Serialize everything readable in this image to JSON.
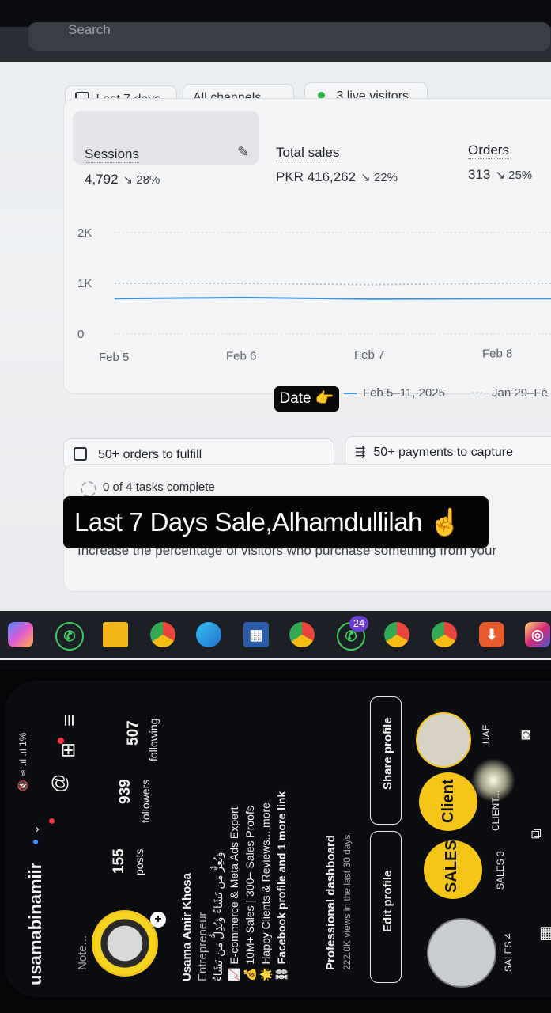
{
  "laptop": {
    "search_placeholder": "Search",
    "filters": {
      "date_range": "Last 7 days",
      "channels": "All channels",
      "live_visitors": "3 live visitors"
    },
    "metrics": [
      {
        "label": "Sessions",
        "value": "4,792",
        "change": "28%"
      },
      {
        "label": "Total sales",
        "value": "PKR 416,262",
        "change": "22%"
      },
      {
        "label": "Orders",
        "value": "313",
        "change": "25%"
      }
    ],
    "chart_data": {
      "type": "line",
      "title": "",
      "xlabel": "",
      "ylabel": "",
      "y_ticks": [
        "2K",
        "1K",
        "0"
      ],
      "ylim": [
        0,
        2000
      ],
      "categories": [
        "Feb 5",
        "Feb 6",
        "Feb 7",
        "Feb 8"
      ],
      "series": [
        {
          "name": "Feb 5–11, 2025",
          "values": [
            700,
            720,
            690,
            700
          ],
          "style": "solid",
          "color": "#3d8fd6"
        },
        {
          "name": "Jan 29–Fe",
          "values": [
            1000,
            1000,
            970,
            1000
          ],
          "style": "dotted",
          "color": "#a9b8c9"
        }
      ],
      "grid": true
    },
    "date_sticker": "Date 👉",
    "actions": {
      "orders": "50+ orders to fulfill",
      "payments": "50+ payments to capture"
    },
    "tasks": {
      "status": "0 of 4 tasks complete",
      "description": "Increase the percentage of visitors who purchase something from your"
    },
    "headline": "Last 7 Days Sale,Alhamdullilah ☝️",
    "taskbar_badge": "24"
  },
  "phone": {
    "status": "🔇 ≋ .ıl .ıl 1%",
    "username": "usamabinamiir",
    "note": "Note...",
    "stats": [
      {
        "value": "155",
        "label": "posts"
      },
      {
        "value": "939",
        "label": "followers"
      },
      {
        "value": "507",
        "label": "following"
      }
    ],
    "bio": {
      "name": "Usama Amir Khosa",
      "category": "Entrepreneur",
      "arabic": "وَتُعِزُّ مَن تَشَاءُ وَتُذِلُّ مَن تَشَاءُ",
      "line1": "📈 E-commerce & Meta Ads Expert",
      "line2": "💰 10M+ Sales | 300+ Sales Proofs",
      "line3": "🌟 Happy Clients & Reviews... more",
      "link": "Facebook profile and 1 more link"
    },
    "dashboard": {
      "title": "Professional dashboard",
      "sub": "222.0K views in the last 30 days."
    },
    "buttons": {
      "edit": "Edit profile",
      "share": "Share profile"
    },
    "highlights": [
      {
        "label": "SALES 4",
        "cover": ""
      },
      {
        "label": "SALES 3",
        "cover": "SALES"
      },
      {
        "label": "CLIENT...",
        "cover": "Client"
      },
      {
        "label": "UAE",
        "cover": ""
      }
    ]
  }
}
